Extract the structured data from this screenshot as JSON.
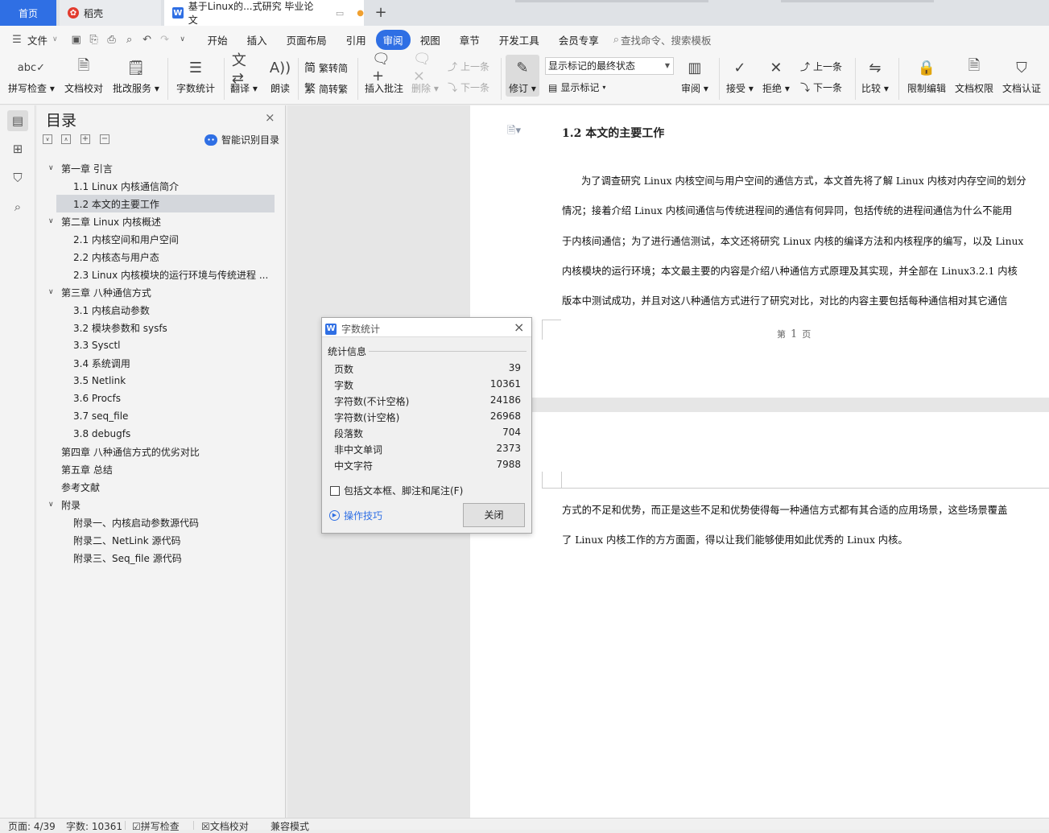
{
  "tabs": {
    "home": "首页",
    "daoke": "稻壳",
    "doc": "基于Linux的...式研究 毕业论文"
  },
  "menu": {
    "file": "文件",
    "items": [
      "开始",
      "插入",
      "页面布局",
      "引用",
      "审阅",
      "视图",
      "章节",
      "开发工具",
      "会员专享"
    ],
    "search": "查找命令、搜索模板"
  },
  "ribbon": {
    "spell": "拼写检查",
    "proof": "文档校对",
    "batch": "批改服务",
    "wordcount": "字数统计",
    "translate": "翻译",
    "read": "朗读",
    "to_trad": "繁转简",
    "to_simp": "简转繁",
    "insert_comment": "插入批注",
    "delete": "删除",
    "prev": "上一条",
    "next": "下一条",
    "track": "修订",
    "markup_state": "显示标记的最终状态",
    "show_markup": "显示标记",
    "review": "审阅",
    "accept": "接受",
    "reject": "拒绝",
    "prev2": "上一条",
    "next2": "下一条",
    "compare": "比较",
    "restrict": "限制编辑",
    "permission": "文档权限",
    "certify": "文档认证"
  },
  "toc": {
    "title": "目录",
    "smart": "智能识别目录",
    "items": [
      {
        "text": "第一章  引言",
        "level": 1,
        "arrow": true
      },
      {
        "text": "1.1 Linux 内核通信简介",
        "level": 2
      },
      {
        "text": "1.2  本文的主要工作",
        "level": 2,
        "selected": true
      },
      {
        "text": "第二章  Linux 内核概述",
        "level": 1,
        "arrow": true
      },
      {
        "text": "2.1  内核空间和用户空间",
        "level": 2
      },
      {
        "text": "2.2  内核态与用户态",
        "level": 2
      },
      {
        "text": "2.3 Linux  内核模块的运行环境与传统进程 ...",
        "level": 2
      },
      {
        "text": "第三章  八种通信方式",
        "level": 1,
        "arrow": true
      },
      {
        "text": "3.1  内核启动参数",
        "level": 2
      },
      {
        "text": "3.2  模块参数和 sysfs",
        "level": 2
      },
      {
        "text": "3.3 Sysctl",
        "level": 2
      },
      {
        "text": "3.4  系统调用",
        "level": 2
      },
      {
        "text": "3.5 Netlink",
        "level": 2
      },
      {
        "text": "3.6 Procfs",
        "level": 2
      },
      {
        "text": "3.7 seq_file",
        "level": 2
      },
      {
        "text": "3.8 debugfs",
        "level": 2
      },
      {
        "text": "第四章  八种通信方式的优劣对比",
        "level": 1
      },
      {
        "text": "第五章  总结",
        "level": 1
      },
      {
        "text": "参考文献",
        "level": 1
      },
      {
        "text": "附录",
        "level": 1,
        "arrow": true
      },
      {
        "text": "附录一、内核启动参数源代码",
        "level": 2
      },
      {
        "text": "附录二、NetLink  源代码",
        "level": 2
      },
      {
        "text": "附录三、Seq_file  源代码",
        "level": 2
      }
    ]
  },
  "doc": {
    "heading": "1.2  本文的主要工作",
    "lines": [
      "为了调查研究 Linux 内核空间与用户空间的通信方式，本文首先将了解 Linux 内核对内存空间的划分",
      "情况；接着介绍 Linux 内核间通信与传统进程间的通信有何异同，包括传统的进程间通信为什么不能用",
      "于内核间通信；为了进行通信测试，本文还将研究 Linux 内核的编译方法和内核程序的编写，以及 Linux",
      "内核模块的运行环境；本文最主要的内容是介绍八种通信方式原理及其实现，并全部在 Linux3.2.1 内核",
      "版本中测试成功，并且对这八种通信方式进行了研究对比，对比的内容主要包括每种通信相对其它通信"
    ],
    "footer_pre": "第",
    "footer_num": "1",
    "footer_post": "页",
    "page2_lines": [
      "方式的不足和优势，而正是这些不足和优势使得每一种通信方式都有其合适的应用场景，这些场景覆盖",
      "了 Linux 内核工作的方方面面，得以让我们能够使用如此优秀的 Linux 内核。"
    ]
  },
  "dialog": {
    "title": "字数统计",
    "section": "统计信息",
    "stats": [
      {
        "label": "页数",
        "value": "39"
      },
      {
        "label": "字数",
        "value": "10361"
      },
      {
        "label": "字符数(不计空格)",
        "value": "24186"
      },
      {
        "label": "字符数(计空格)",
        "value": "26968"
      },
      {
        "label": "段落数",
        "value": "704"
      },
      {
        "label": "非中文单词",
        "value": "2373"
      },
      {
        "label": "中文字符",
        "value": "7988"
      }
    ],
    "checkbox": "包括文本框、脚注和尾注(F)",
    "tips": "操作技巧",
    "close": "关闭"
  },
  "status": {
    "page": "页面: 4/39",
    "words": "字数: 10361",
    "spell": "拼写检查",
    "proof": "文档校对",
    "compat": "兼容模式"
  }
}
